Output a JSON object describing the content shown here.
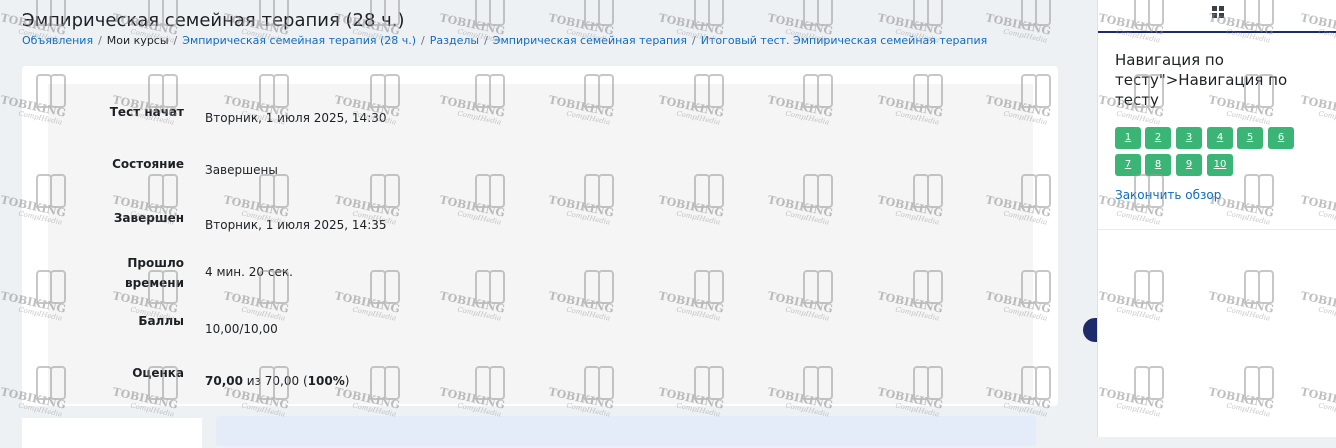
{
  "header": {
    "title": "Эмпирическая семейная терапия (28 ч.)"
  },
  "breadcrumb": [
    {
      "label": "Объявления",
      "link": true
    },
    {
      "label": "Мои курсы",
      "link": false
    },
    {
      "label": "Эмпирическая семейная терапия (28 ч.)",
      "link": true
    },
    {
      "label": "Разделы",
      "link": true
    },
    {
      "label": "Эмпирическая семейная терапия",
      "link": true
    },
    {
      "label": "Итоговый тест. Эмпирическая семейная терапия",
      "link": true
    }
  ],
  "summary": {
    "started_label": "Тест начат",
    "started_value": "Вторник, 1 июля 2025, 14:30",
    "state_label": "Состояние",
    "state_value": "Завершены",
    "completed_label": "Завершен",
    "completed_value": "Вторник, 1 июля 2025, 14:35",
    "time_label_1": "Прошло",
    "time_label_2": "времени",
    "time_value": "4 мин. 20 сек.",
    "marks_label": "Баллы",
    "marks_value": "10,00/10,00",
    "grade_label": "Оценка",
    "grade_score": "70,00",
    "grade_of": " из 70,00 (",
    "grade_percent": "100%",
    "grade_close": ")"
  },
  "drawer": {
    "nav_title": "Навигация по тесту\">Навигация по тесту",
    "questions": [
      "1",
      "2",
      "3",
      "4",
      "5",
      "6",
      "7",
      "8",
      "9",
      "10"
    ],
    "finish_review": "Закончить обзор",
    "question_color": "#3bb575"
  },
  "watermark": {
    "brand": "TOBIKING",
    "tagline": "CompIHedia"
  },
  "colors": {
    "link": "#0f6cbf",
    "accent_navy": "#1d2b6b",
    "page_bg": "#eef1f4"
  }
}
